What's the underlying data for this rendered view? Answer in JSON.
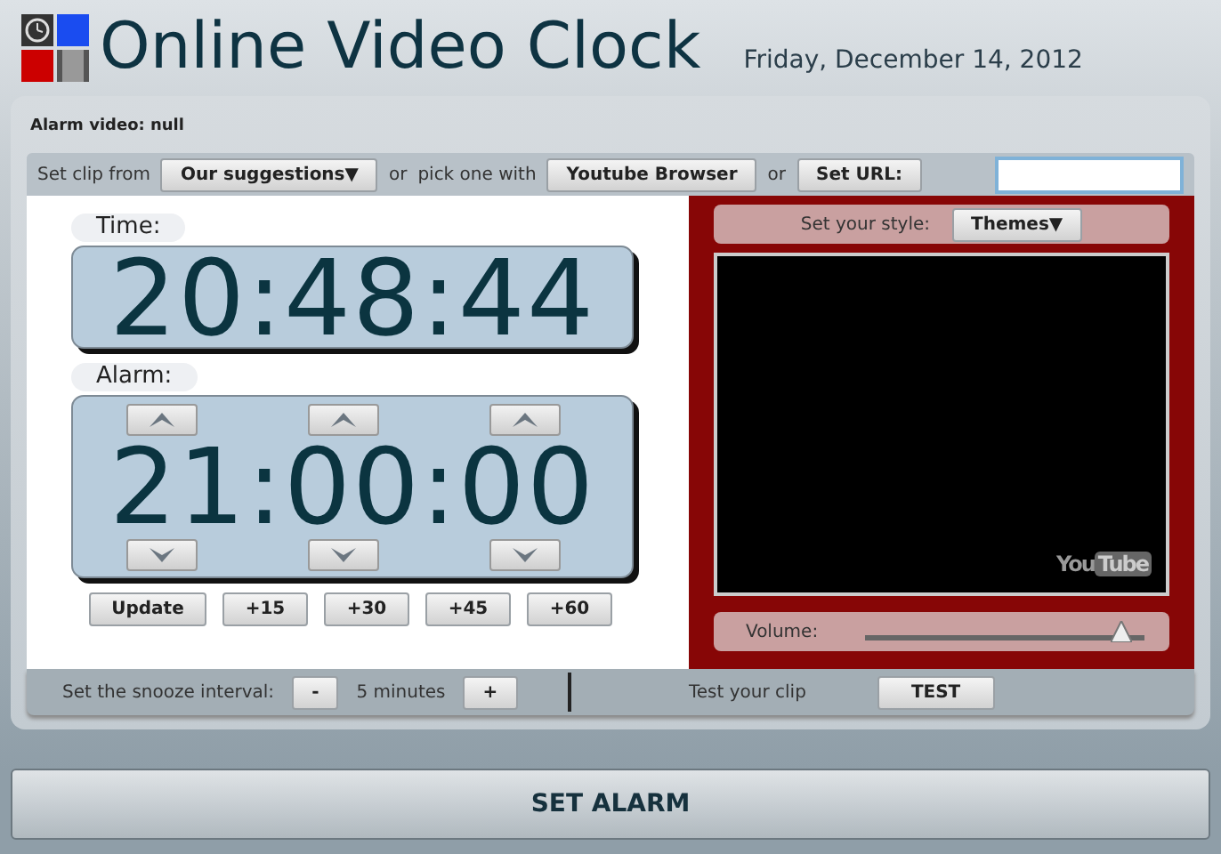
{
  "header": {
    "title": "Online Video Clock",
    "date": "Friday, December 14, 2012"
  },
  "alarm_video": "Alarm video: null",
  "clip_bar": {
    "label": "Set clip from",
    "suggestions": "Our suggestions▼",
    "or_1": "or",
    "pick_label": "pick one with",
    "browser_button": "Youtube Browser",
    "or_2": "or",
    "url_button": "Set URL:"
  },
  "time": {
    "label": "Time:",
    "value": "20:48:44"
  },
  "alarm": {
    "label": "Alarm:",
    "value": "21:00:00"
  },
  "alarm_buttons": [
    "Update",
    "+15",
    "+30",
    "+45",
    "+60"
  ],
  "style": {
    "label": "Set your style:",
    "button": "Themes▼"
  },
  "video_logo": {
    "you": "You",
    "tube": "Tube"
  },
  "volume": {
    "label": "Volume:",
    "level": 0.95
  },
  "snooze": {
    "label": "Set the snooze interval:",
    "minus": "-",
    "value": "5 minutes",
    "plus": "+"
  },
  "test": {
    "label": "Test your clip",
    "button": "TEST"
  },
  "set_alarm": "SET ALARM"
}
